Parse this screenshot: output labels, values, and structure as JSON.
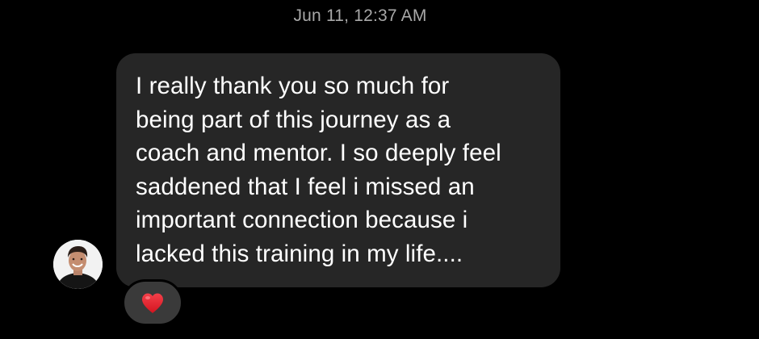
{
  "thread": {
    "timestamp": "Jun 11, 12:37 AM"
  },
  "message": {
    "text": "I really thank you so much for\nbeing part of this journey as a\ncoach and mentor. I so deeply feel\nsaddened that I feel i missed an\nimportant connection because i\nlacked this training in my life....",
    "reaction_icon": "red-heart-icon"
  },
  "colors": {
    "background": "#000000",
    "bubble": "#262626",
    "reaction_pill": "#3a3a3a",
    "heart": "#e8202c",
    "timestamp": "#a8a8a8"
  }
}
